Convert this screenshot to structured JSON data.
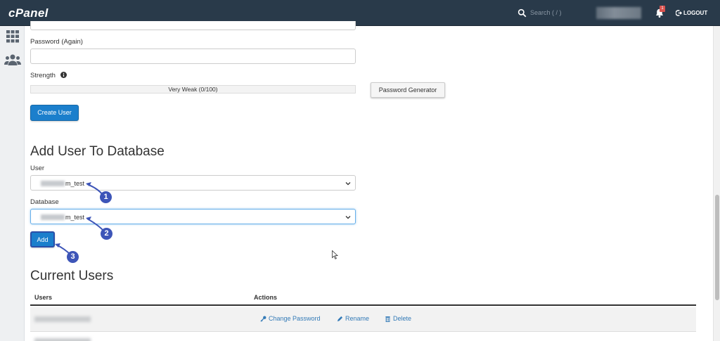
{
  "header": {
    "logo": "cPanel",
    "search_placeholder": "Search ( / )",
    "notification_count": "1",
    "logout_label": "LOGOUT"
  },
  "sidebar": {
    "items": [
      {
        "icon": "grid-icon"
      },
      {
        "icon": "users-icon"
      }
    ]
  },
  "create_user": {
    "password_again_label": "Password (Again)",
    "password_again_value": "",
    "strength_label": "Strength",
    "strength_text": "Very Weak (0/100)",
    "strength_value": 0,
    "password_generator_label": "Password Generator",
    "create_button_label": "Create User"
  },
  "add_user_to_db": {
    "heading": "Add User To Database",
    "user_label": "User",
    "user_value": "m_test",
    "database_label": "Database",
    "database_value": "m_test",
    "add_button_label": "Add"
  },
  "annotations": [
    "1",
    "2",
    "3"
  ],
  "current_users": {
    "heading": "Current Users",
    "columns": [
      "Users",
      "Actions"
    ],
    "actions": {
      "change_password": "Change Password",
      "rename": "Rename",
      "delete": "Delete"
    }
  },
  "colors": {
    "topbar": "#293a4a",
    "primary": "#1b7fcc",
    "link": "#337ab7",
    "marker": "#3d55b8"
  }
}
